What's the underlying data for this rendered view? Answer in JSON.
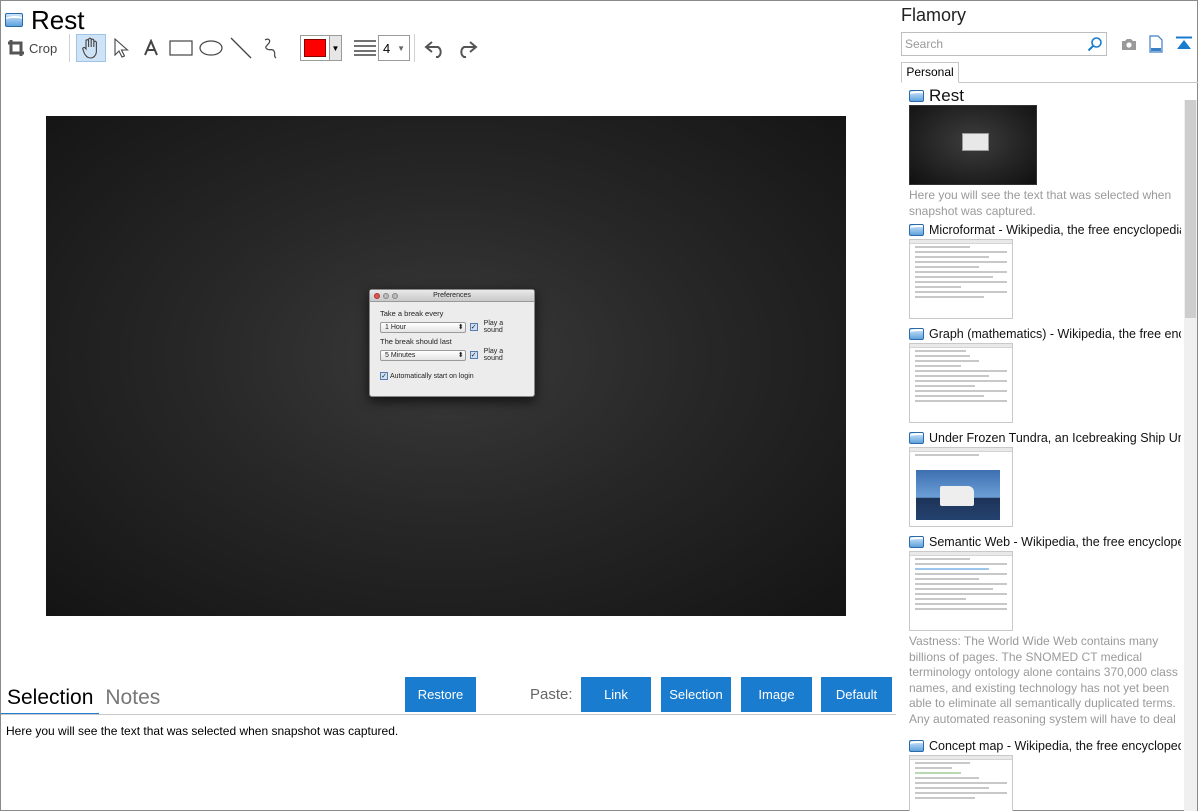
{
  "window": {
    "title": "Rest"
  },
  "toolbar": {
    "crop_label": "Crop",
    "tools": [
      "hand-tool",
      "pointer-tool",
      "text-tool",
      "rectangle-tool",
      "ellipse-tool",
      "line-tool",
      "freehand-tool"
    ],
    "active_tool": "hand-tool",
    "color": "#ff0000",
    "line_width": "4"
  },
  "screenshot": {
    "dialog": {
      "title": "Preferences",
      "label_break_every": "Take a break every",
      "break_every_value": "1 Hour",
      "play_sound_1": "Play a sound",
      "label_break_last": "The break should last",
      "break_last_value": "5 Minutes",
      "play_sound_2": "Play a sound",
      "auto_start": "Automatically start on login"
    }
  },
  "bottom": {
    "tab_selection": "Selection",
    "tab_notes": "Notes",
    "restore": "Restore",
    "paste_label": "Paste:",
    "paste_link": "Link",
    "paste_selection": "Selection",
    "paste_image": "Image",
    "paste_default": "Default",
    "selection_text": "Here you will see the text that was selected when snapshot was captured."
  },
  "sidebar": {
    "title": "Flamory",
    "search_placeholder": "Search",
    "tab_personal": "Personal",
    "items": [
      {
        "title": "Rest",
        "desc": "Here you will see the text that was selected when snapshot was captured."
      },
      {
        "title": "Microformat - Wikipedia, the free encyclopedia"
      },
      {
        "title": "Graph (mathematics) - Wikipedia, the free ency"
      },
      {
        "title": "Under Frozen Tundra, an Icebreaking Ship Unco"
      },
      {
        "title": "Semantic Web - Wikipedia, the free encycloped",
        "desc": "Vastness: The World Wide Web contains many billions of pages. The SNOMED CT medical terminology ontology alone contains 370,000 class names, and existing technology has not yet been able to eliminate all semantically duplicated terms. Any automated reasoning system will have to deal with truly huge inputs."
      },
      {
        "title": "Concept map - Wikipedia, the free encyclopedi"
      }
    ]
  },
  "colors": {
    "accent": "#1a7ccf",
    "tab_underline": "#1e7fd0"
  }
}
